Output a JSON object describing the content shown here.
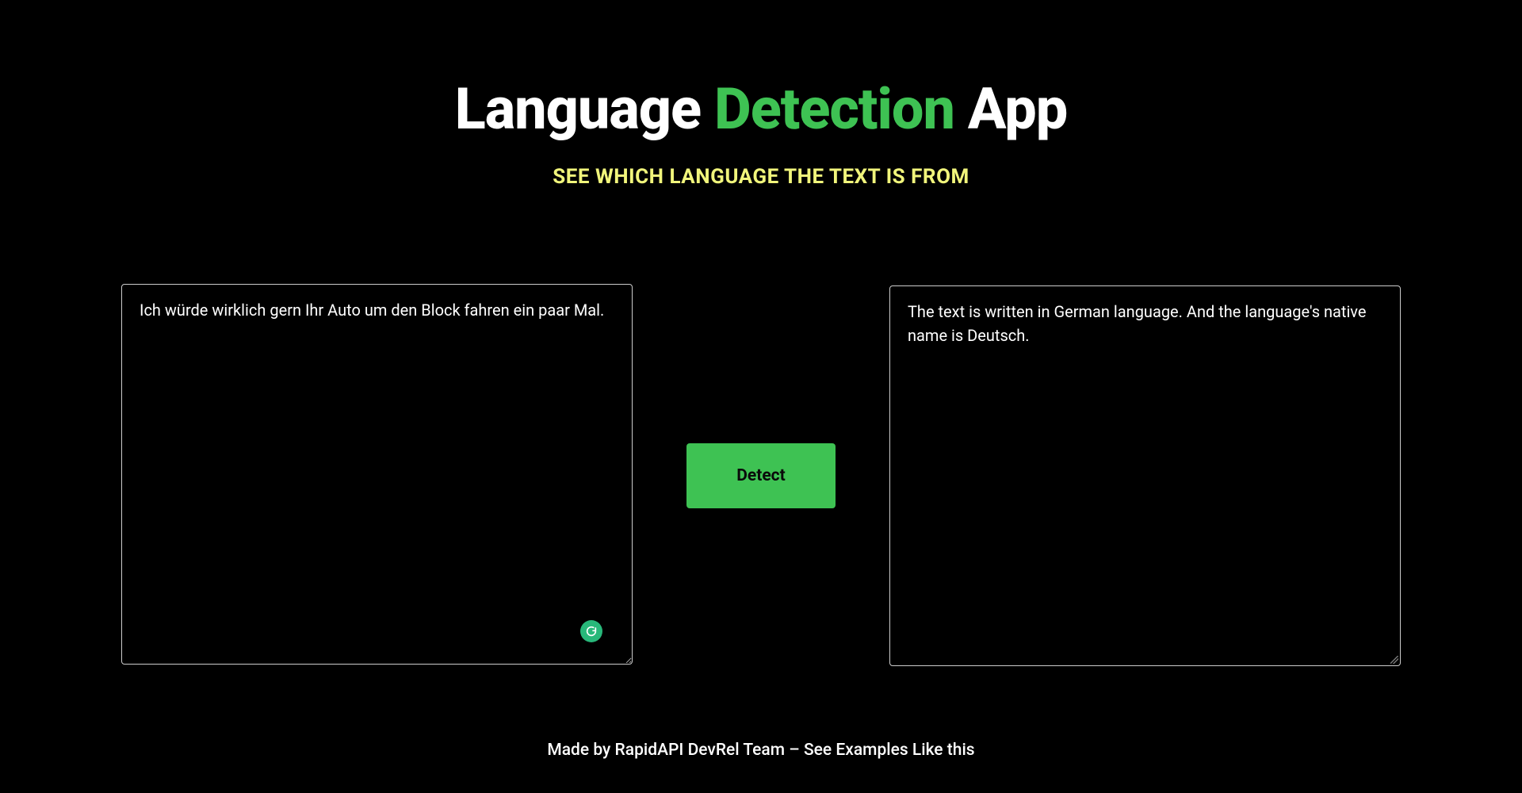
{
  "header": {
    "title_prefix": "Language ",
    "title_accent": "Detection",
    "title_suffix": " App",
    "subtitle": "SEE WHICH LANGUAGE THE TEXT IS FROM"
  },
  "input": {
    "value": "Ich würde wirklich gern Ihr Auto um den Block fahren ein paar Mal.",
    "placeholder": ""
  },
  "button": {
    "detect_label": "Detect"
  },
  "output": {
    "text": "The text is written in German language. And the language's native name is Deutsch."
  },
  "footer": {
    "text": "Made by RapidAPI DevRel Team – See Examples Like this"
  },
  "colors": {
    "accent": "#3ec253",
    "subtitle": "#f1f57b",
    "background": "#000000"
  },
  "icons": {
    "grammarly": "grammarly-icon"
  }
}
